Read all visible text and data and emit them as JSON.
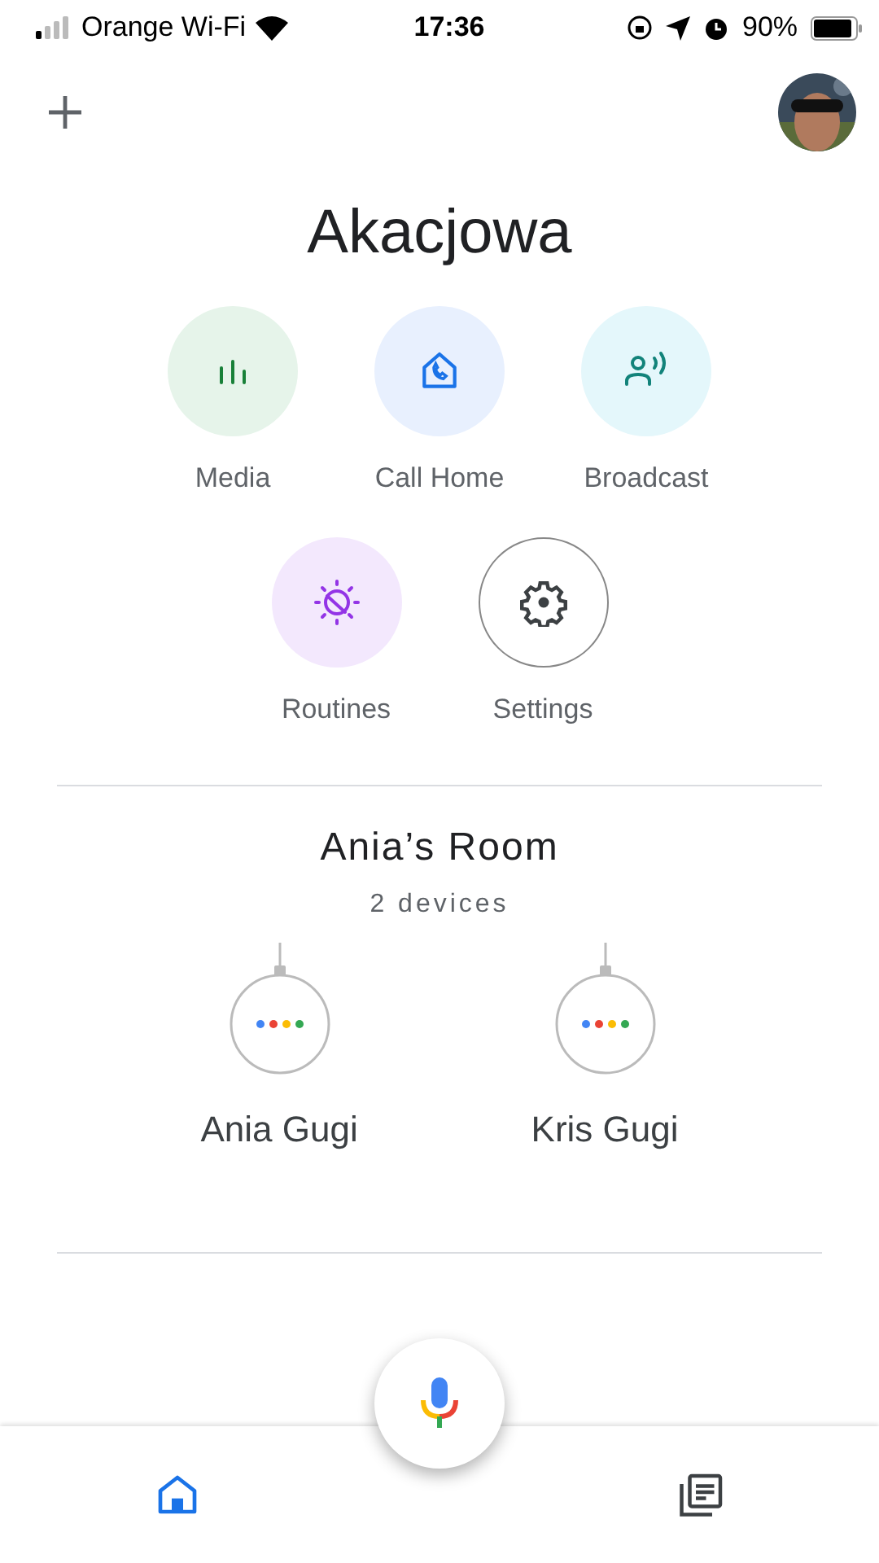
{
  "status_bar": {
    "carrier": "Orange Wi-Fi",
    "time": "17:36",
    "battery": "90%"
  },
  "header": {
    "title": "Akacjowa"
  },
  "actions": [
    {
      "label": "Media",
      "kind": "tinted",
      "color": "#e6f4ea"
    },
    {
      "label": "Call Home",
      "kind": "tinted",
      "color": "#e8f0fe"
    },
    {
      "label": "Broadcast",
      "kind": "tinted",
      "color": "#e4f7fb"
    },
    {
      "label": "Routines",
      "kind": "tinted",
      "color": "#f3e8fd"
    },
    {
      "label": "Settings",
      "kind": "outlined"
    }
  ],
  "room": {
    "title": "Ania’s Room",
    "subtitle": "2 devices",
    "devices": [
      {
        "name": "Ania Gugi"
      },
      {
        "name": "Kris Gugi"
      }
    ]
  },
  "bottom_nav": [
    {
      "selected": true
    },
    {
      "selected": false
    }
  ]
}
